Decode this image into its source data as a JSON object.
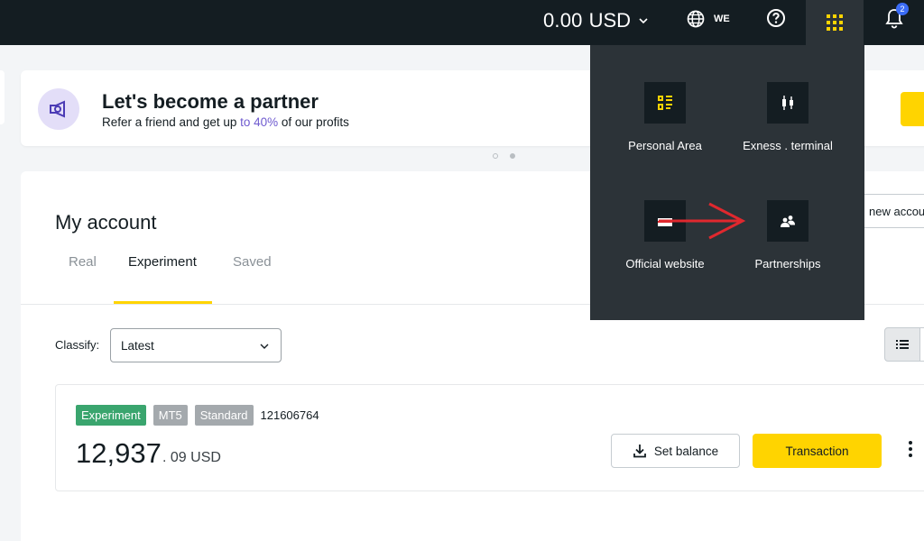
{
  "topbar": {
    "balance_amount": "0.00",
    "balance_currency": "USD",
    "language_code": "WE",
    "notification_count": "2"
  },
  "banner": {
    "title": "Let's become a partner",
    "subtitle_before": "Refer a friend and get up ",
    "subtitle_highlight": "to 40%",
    "subtitle_after": " of our profits"
  },
  "account": {
    "title": "My account",
    "tabs": [
      {
        "label": "Real",
        "active": false
      },
      {
        "label": "Experiment",
        "active": true
      },
      {
        "label": "Saved",
        "active": false
      }
    ],
    "new_account_label": "new accou",
    "classify_label": "Classify:",
    "classify_value": "Latest"
  },
  "account_row": {
    "badges": [
      "Experiment",
      "MT5",
      "Standard"
    ],
    "account_number": "121606764",
    "balance_whole": "12,937",
    "balance_fraction": ". 09 USD",
    "set_balance_label": "Set balance",
    "transaction_label": "Transaction"
  },
  "apps_menu": {
    "items": [
      {
        "label": "Personal Area",
        "icon": "personal-area-icon"
      },
      {
        "label": "Exness . terminal",
        "icon": "candlestick-icon"
      },
      {
        "label": "Official website",
        "icon": "website-icon"
      },
      {
        "label": "Partnerships",
        "icon": "partners-icon"
      }
    ]
  },
  "colors": {
    "topbar": "#141d22",
    "accent_yellow": "#ffd400",
    "menu_bg": "#2c3338",
    "badge_green": "#3aa56e",
    "highlight_purple": "#6e5acf",
    "arrow_red": "#e0282e"
  }
}
